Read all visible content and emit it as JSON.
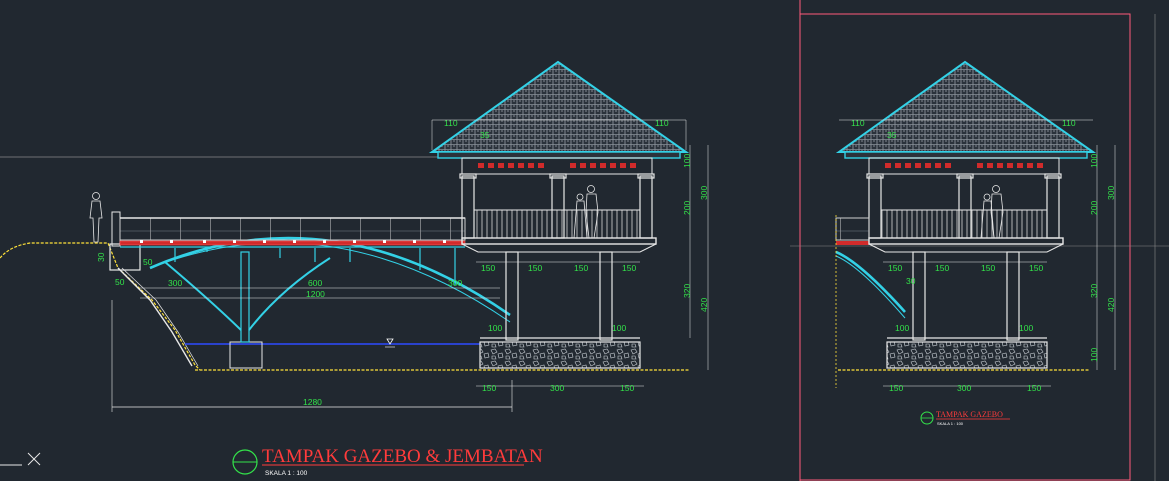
{
  "drawing": {
    "main_title": "TAMPAK GAZEBO & JEMBATAN",
    "main_scale": "SKALA 1 : 100",
    "side_title": "TAMPAK GAZEBO",
    "side_scale": "SKALA 1 : 100"
  },
  "colors": {
    "background": "#212830",
    "dimension": "#33e24a",
    "structure": "#33d1e6",
    "outline": "#e8e8e8",
    "title": "#ff3b3b",
    "water": "#2d4bff",
    "terrain": "#ffe23a",
    "frame": "#ff5a7a"
  },
  "dimensions": {
    "roof_overhang_left": "110",
    "roof_overhang_right": "110",
    "roof_label": "35",
    "roof_rise": "100",
    "column_height": "200",
    "upper_total": "300",
    "pile_height": "320",
    "lower_total": "420",
    "foundation_height": "100",
    "bay_left": "150",
    "bay_center": "150",
    "bay_center_b": "150",
    "bay_right": "150",
    "footing_left": "100",
    "footing_right": "100",
    "base_left": "150",
    "base_center": "300",
    "base_right": "150",
    "abutment_depth": "30",
    "abutment_width": "50",
    "abutment_step": "50",
    "span_left": "300",
    "span_center": "600",
    "span_right": "300",
    "span_total": "1200",
    "overall_length": "1280"
  },
  "icons": [
    "human-figure-icon",
    "water-level-icon",
    "section-marker-icon",
    "ucs-axis-icon"
  ]
}
